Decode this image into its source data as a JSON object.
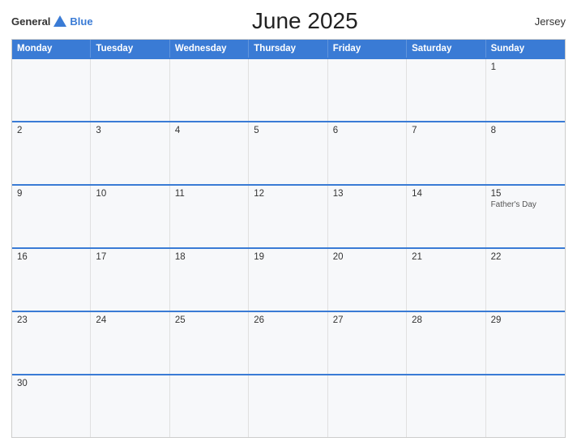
{
  "header": {
    "logo_general": "General",
    "logo_blue": "Blue",
    "title": "June 2025",
    "location": "Jersey"
  },
  "calendar": {
    "days_of_week": [
      "Monday",
      "Tuesday",
      "Wednesday",
      "Thursday",
      "Friday",
      "Saturday",
      "Sunday"
    ],
    "weeks": [
      [
        {
          "day": "",
          "empty": true
        },
        {
          "day": "",
          "empty": true
        },
        {
          "day": "",
          "empty": true
        },
        {
          "day": "",
          "empty": true
        },
        {
          "day": "",
          "empty": true
        },
        {
          "day": "",
          "empty": true
        },
        {
          "day": "1",
          "event": ""
        }
      ],
      [
        {
          "day": "2",
          "event": ""
        },
        {
          "day": "3",
          "event": ""
        },
        {
          "day": "4",
          "event": ""
        },
        {
          "day": "5",
          "event": ""
        },
        {
          "day": "6",
          "event": ""
        },
        {
          "day": "7",
          "event": ""
        },
        {
          "day": "8",
          "event": ""
        }
      ],
      [
        {
          "day": "9",
          "event": ""
        },
        {
          "day": "10",
          "event": ""
        },
        {
          "day": "11",
          "event": ""
        },
        {
          "day": "12",
          "event": ""
        },
        {
          "day": "13",
          "event": ""
        },
        {
          "day": "14",
          "event": ""
        },
        {
          "day": "15",
          "event": "Father's Day"
        }
      ],
      [
        {
          "day": "16",
          "event": ""
        },
        {
          "day": "17",
          "event": ""
        },
        {
          "day": "18",
          "event": ""
        },
        {
          "day": "19",
          "event": ""
        },
        {
          "day": "20",
          "event": ""
        },
        {
          "day": "21",
          "event": ""
        },
        {
          "day": "22",
          "event": ""
        }
      ],
      [
        {
          "day": "23",
          "event": ""
        },
        {
          "day": "24",
          "event": ""
        },
        {
          "day": "25",
          "event": ""
        },
        {
          "day": "26",
          "event": ""
        },
        {
          "day": "27",
          "event": ""
        },
        {
          "day": "28",
          "event": ""
        },
        {
          "day": "29",
          "event": ""
        }
      ],
      [
        {
          "day": "30",
          "event": ""
        },
        {
          "day": "",
          "empty": true
        },
        {
          "day": "",
          "empty": true
        },
        {
          "day": "",
          "empty": true
        },
        {
          "day": "",
          "empty": true
        },
        {
          "day": "",
          "empty": true
        },
        {
          "day": "",
          "empty": true
        }
      ]
    ]
  }
}
